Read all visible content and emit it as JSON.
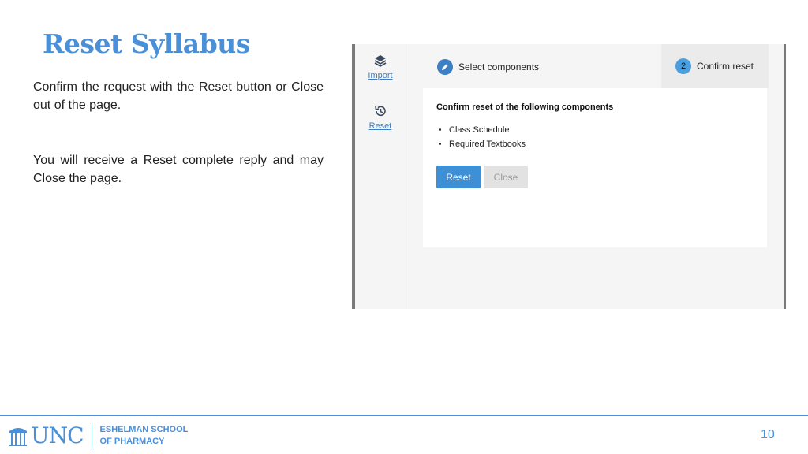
{
  "slide": {
    "title": "Reset Syllabus",
    "paragraphs": [
      "Confirm the request with the Reset button or Close out of the page.",
      "You will receive a Reset complete reply and may Close the page."
    ],
    "page_number": "10"
  },
  "screenshot": {
    "nav": {
      "import_label": "Import",
      "reset_label": "Reset"
    },
    "steps": {
      "step1_label": "Select components",
      "step2_number": "2",
      "step2_label": "Confirm reset"
    },
    "card": {
      "heading": "Confirm reset of the following components",
      "items": [
        "Class Schedule",
        "Required Textbooks"
      ],
      "reset_button": "Reset",
      "close_button": "Close"
    }
  },
  "footer": {
    "logo_word": "UNC",
    "school_line1": "ESHELMAN SCHOOL",
    "school_line2": "OF PHARMACY"
  },
  "colors": {
    "accent": "#4a90d9",
    "primary_button": "#3d8fd6"
  },
  "icons": {
    "import": "layers-icon",
    "reset": "history-icon",
    "step1": "pencil-icon",
    "logo": "old-well-icon"
  }
}
